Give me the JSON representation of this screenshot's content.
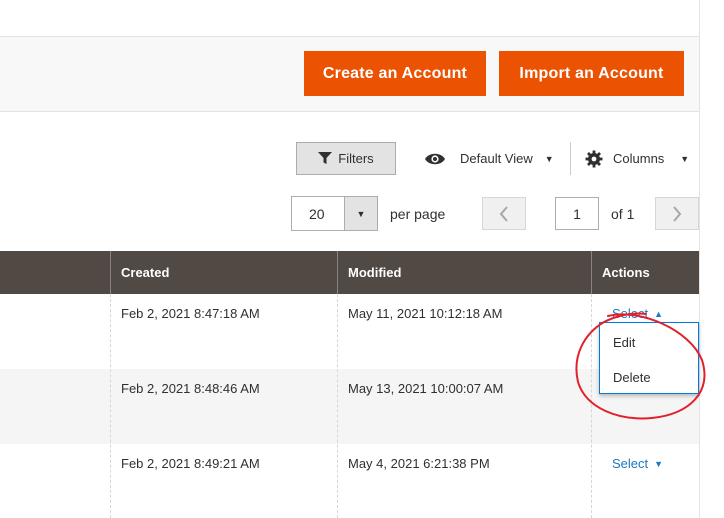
{
  "toolbar": {
    "create_label": "Create an Account",
    "import_label": "Import an Account"
  },
  "controls": {
    "filters_label": "Filters",
    "view_label": "Default View",
    "columns_label": "Columns"
  },
  "pagination": {
    "per_page_value": "20",
    "per_page_label": "per page",
    "current_page": "1",
    "of_label": "of 1"
  },
  "grid": {
    "columns": [
      "Created",
      "Modified",
      "Actions"
    ],
    "rows": [
      {
        "created": "Feb 2, 2021 8:47:18 AM",
        "modified": "May 11, 2021 10:12:18 AM",
        "action": "Select"
      },
      {
        "created": "Feb 2, 2021 8:48:46 AM",
        "modified": "May 13, 2021 10:00:07 AM",
        "action": ""
      },
      {
        "created": "Feb 2, 2021 8:49:21 AM",
        "modified": "May 4, 2021 6:21:38 PM",
        "action": "Select"
      }
    ]
  },
  "action_menu": {
    "items": [
      "Edit",
      "Delete"
    ]
  },
  "colors": {
    "accent": "#eb5202",
    "header_bg": "#514943",
    "link": "#1979c3",
    "annotation": "#e0202a"
  },
  "icons": {
    "filter": "funnel-icon",
    "view": "eye-icon",
    "columns": "gear-icon",
    "prev": "chevron-left-icon",
    "next": "chevron-right-icon"
  }
}
